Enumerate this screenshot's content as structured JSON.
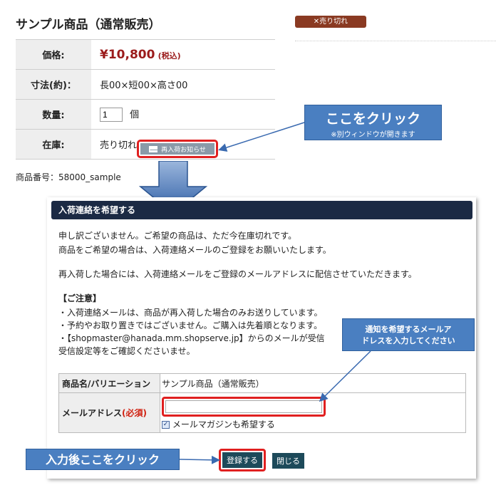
{
  "product": {
    "title": "サンプル商品（通常販売）",
    "soldout_badge": "✕売り切れ",
    "price_label": "価格:",
    "price": "¥10,800",
    "tax_note": "(税込)",
    "size_label": "寸法(約)：",
    "size_value": "長00×短00×高さ00",
    "qty_label": "数量:",
    "qty_value": "1",
    "qty_unit": "個",
    "stock_label": "在庫:",
    "stock_value": "売り切れ",
    "restock_button": "再入荷お知らせ",
    "product_code": "商品番号：58000_sample"
  },
  "callouts": {
    "click_here": "ここをクリック",
    "click_here_note": "※別ウィンドウが開きます",
    "email_note_line1": "通知を希望するメールア",
    "email_note_line2": "ドレスを入力してください",
    "after_input": "入力後ここをクリック"
  },
  "modal": {
    "header": "入荷連絡を希望する",
    "lines": [
      "申し訳ございません。ご希望の商品は、ただ今在庫切れです。",
      "商品をご希望の場合は、入荷連絡メールのご登録をお願いいたします。",
      "再入荷した場合には、入荷連絡メールをご登録のメールアドレスに配信させていただきます。",
      "【ご注意】",
      "・入荷連絡メールは、商品が再入荷した場合のみお送りしています。",
      "・予約やお取り置きではございません。ご購入は先着順となります。",
      "・【shopmaster@hanada.mm.shopserve.jp】からのメールが受信",
      "受信設定等をご確認くださいませ。"
    ],
    "form": {
      "item_label": "商品名/バリエーション",
      "item_value": "サンプル商品（通常販売）",
      "email_label": "メールアドレス",
      "email_required": "(必須)",
      "email_value": "",
      "magazine_checked": "✓",
      "magazine_label": "メールマガジンも希望する"
    },
    "submit_button": "登録する",
    "close_button": "閉じる"
  },
  "colors": {
    "accent_blue": "#4a7fc1",
    "header_navy": "#1b2a44",
    "price_red": "#9b1b1b",
    "highlight_red": "#e02020",
    "button_teal": "#1d4a5a"
  }
}
